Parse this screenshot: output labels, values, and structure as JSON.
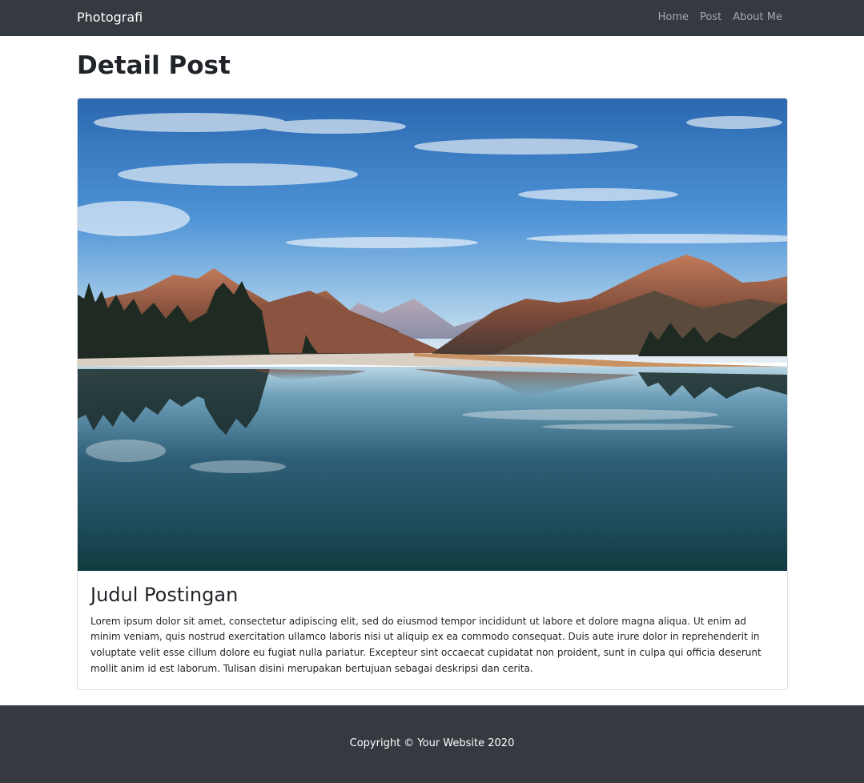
{
  "navbar": {
    "brand": "Photografi",
    "links": [
      "Home",
      "Post",
      "About Me"
    ]
  },
  "page": {
    "title": "Detail Post"
  },
  "post": {
    "image": {
      "subject": "mountain-lake-landscape"
    },
    "title": "Judul Postingan",
    "body": "Lorem ipsum dolor sit amet, consectetur adipiscing elit, sed do eiusmod tempor incididunt ut labore et dolore magna aliqua. Ut enim ad minim veniam, quis nostrud exercitation ullamco laboris nisi ut aliquip ex ea commodo consequat. Duis aute irure dolor in reprehenderit in voluptate velit esse cillum dolore eu fugiat nulla pariatur. Excepteur sint occaecat cupidatat non proident, sunt in culpa qui officia deserunt mollit anim id est laborum. Tulisan disini merupakan bertujuan sebagai deskripsi dan cerita."
  },
  "footer": {
    "copyright": "Copyright © Your Website 2020"
  },
  "colors": {
    "navbar_bg": "#343a40",
    "footer_bg": "#343a40",
    "nav_link": "#9a9da0",
    "text": "#212529"
  }
}
